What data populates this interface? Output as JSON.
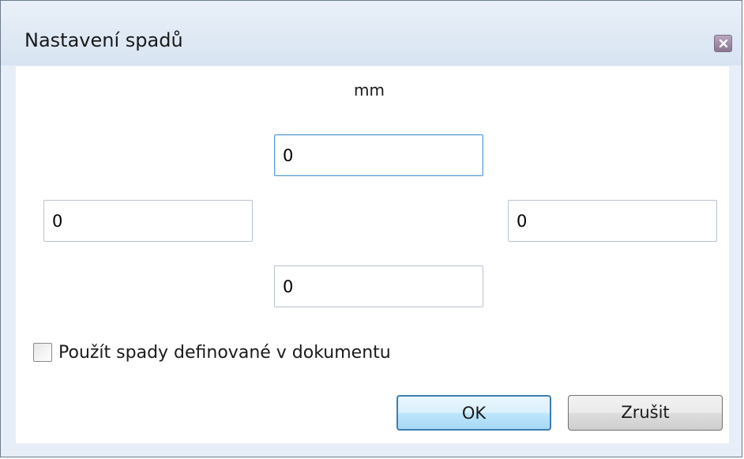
{
  "dialog": {
    "title": "Nastavení spadů",
    "close_icon": "close-icon"
  },
  "bleed": {
    "unit": "mm",
    "top": "0",
    "left": "0",
    "right": "0",
    "bottom": "0"
  },
  "use_document_bleeds": {
    "label": "Použít spady definované v dokumentu",
    "checked": false
  },
  "buttons": {
    "ok_label": "OK",
    "cancel_label": "Zrušit"
  }
}
